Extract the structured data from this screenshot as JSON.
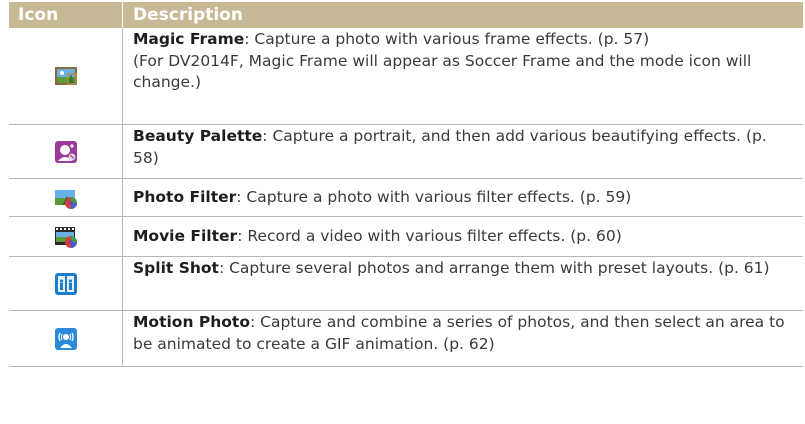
{
  "header": {
    "icon_label": "Icon",
    "description_label": "Description"
  },
  "rows": [
    {
      "icon": "magic-frame-icon",
      "name": "Magic Frame",
      "text": ": Capture a photo with various frame effects. (p. 57)",
      "note": "(For DV2014F, Magic Frame will appear as Soccer Frame and the mode icon will change.)"
    },
    {
      "icon": "beauty-palette-icon",
      "name": "Beauty Palette",
      "text": ": Capture a portrait, and then add various beautifying effects. (p. 58)"
    },
    {
      "icon": "photo-filter-icon",
      "name": "Photo Filter",
      "text": ": Capture a photo with various filter effects. (p. 59)"
    },
    {
      "icon": "movie-filter-icon",
      "name": "Movie Filter",
      "text": ": Record a video with various filter effects. (p. 60)"
    },
    {
      "icon": "split-shot-icon",
      "name": "Split Shot",
      "text": ": Capture several photos and arrange them with preset layouts. (p. 61)"
    },
    {
      "icon": "motion-photo-icon",
      "name": "Motion Photo",
      "text": ": Capture and combine a series of photos, and then select an area to be animated to create a GIF animation. (p. 62)"
    }
  ],
  "colors": {
    "header_bg": "#c8b996",
    "border": "#b7b7b7",
    "text": "#3a3a3a"
  }
}
